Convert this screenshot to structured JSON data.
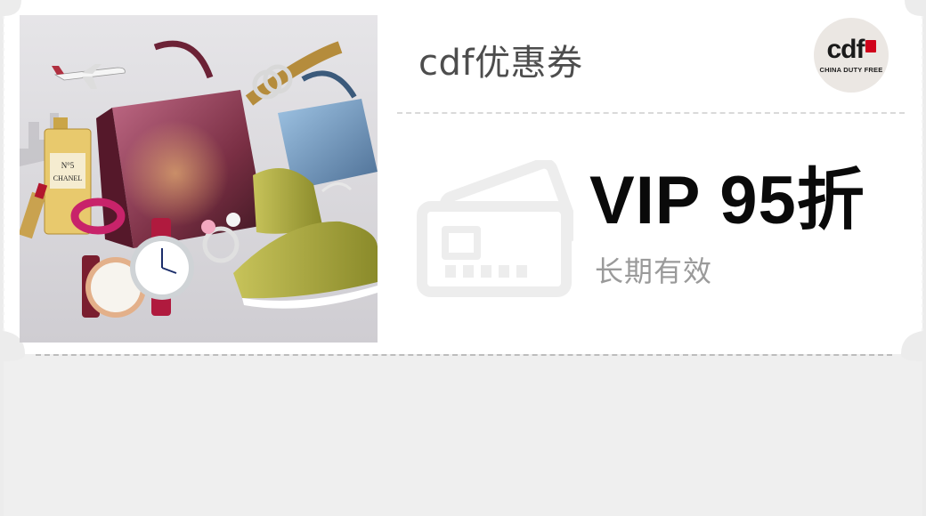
{
  "coupon": {
    "title": "cdf优惠券",
    "discount": "VIP 95折",
    "validity": "长期有效"
  },
  "brand": {
    "logo_text": "cdf",
    "logo_subtext": "CHINA DUTY FREE"
  },
  "product_image": {
    "label": "CHANEL"
  },
  "colors": {
    "card_top": "#ffffff",
    "card_bottom": "#efefef",
    "page_bg": "#ececec",
    "title_text": "#4d4d4d",
    "discount_text": "#0a0a0a",
    "validity_text": "#9a9a9a",
    "logo_seal": "#d0021b"
  }
}
